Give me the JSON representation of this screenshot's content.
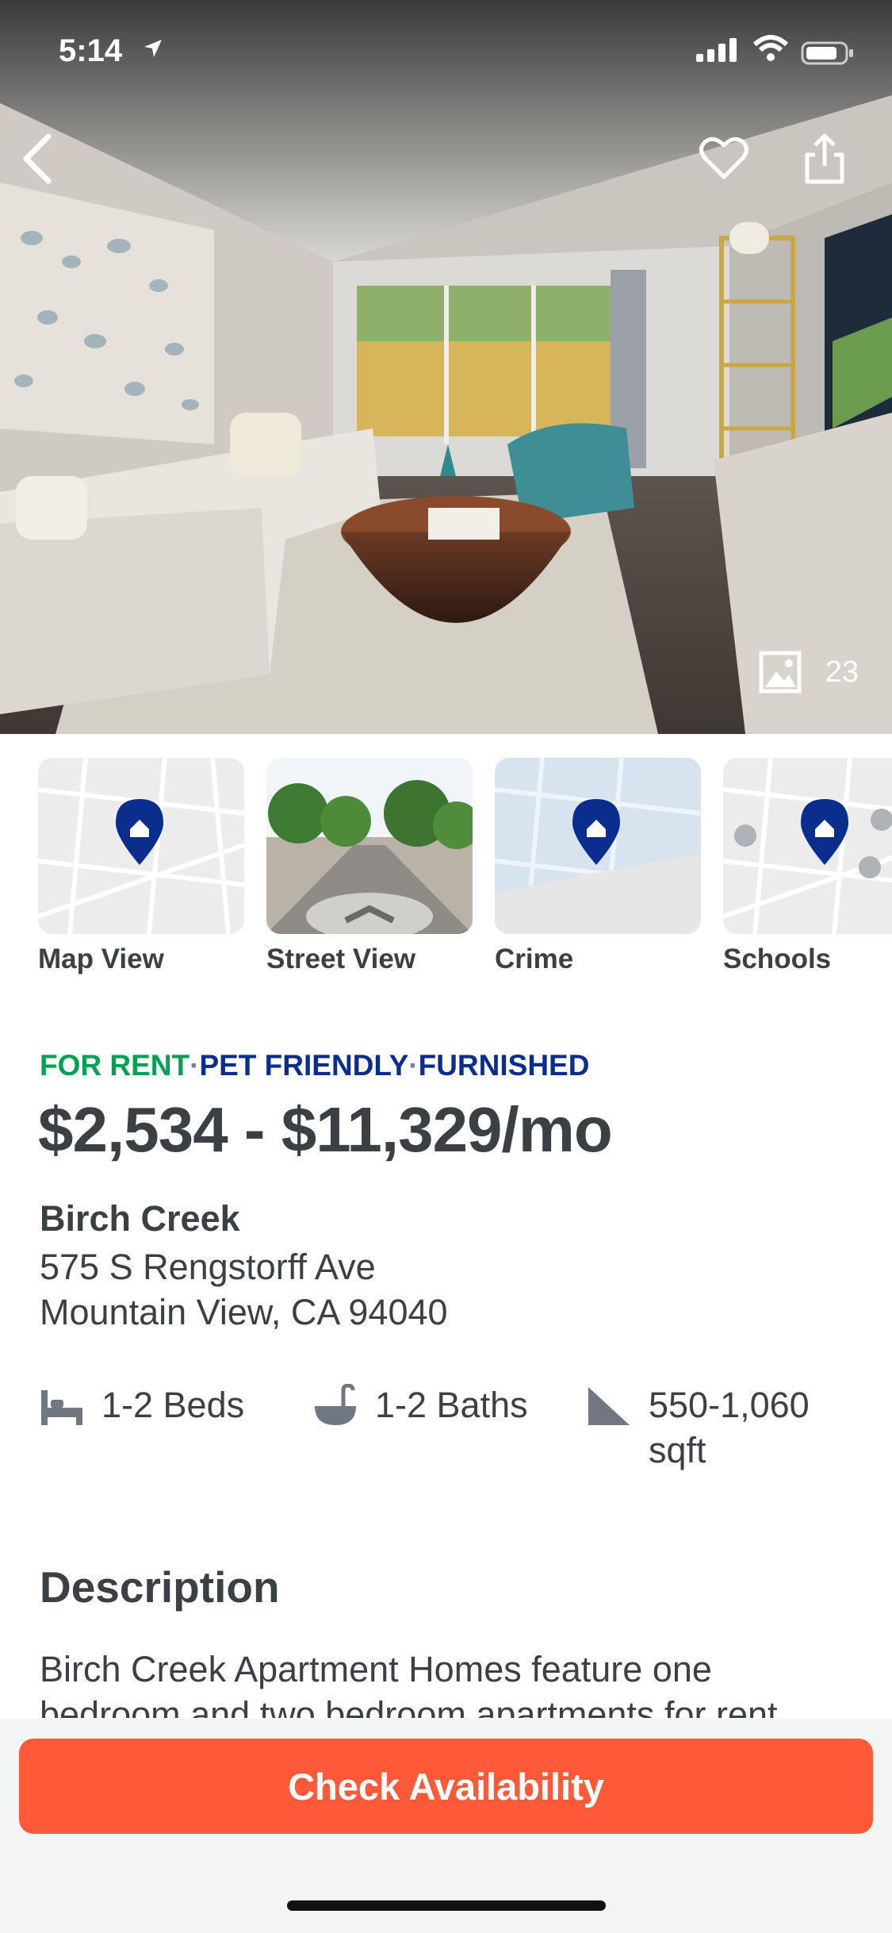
{
  "status_bar": {
    "time": "5:14"
  },
  "gallery": {
    "photo_count": "23"
  },
  "quick_links": [
    {
      "label": "Map View"
    },
    {
      "label": "Street View"
    },
    {
      "label": "Crime"
    },
    {
      "label": "Schools"
    }
  ],
  "listing": {
    "tags": [
      "FOR RENT",
      "PET FRIENDLY",
      "FURNISHED"
    ],
    "tag_separator": "·",
    "price": "$2,534 - $11,329/mo",
    "name": "Birch Creek",
    "address_line1": "575 S Rengstorff Ave",
    "address_line2": "Mountain View, CA 94040",
    "beds": "1-2 Beds",
    "baths": "1-2 Baths",
    "sqft_line1": "550-1,060",
    "sqft_line2": "sqft"
  },
  "description": {
    "title": "Description",
    "text": "Birch Creek Apartment Homes feature one bedroom and two bedroom apartments for rent"
  },
  "footer": {
    "cta_label": "Check Availability"
  },
  "colors": {
    "green": "#00a152",
    "blue": "#0b2d8d",
    "cta": "#fe5a39",
    "map_pin": "#0b2d8d"
  }
}
